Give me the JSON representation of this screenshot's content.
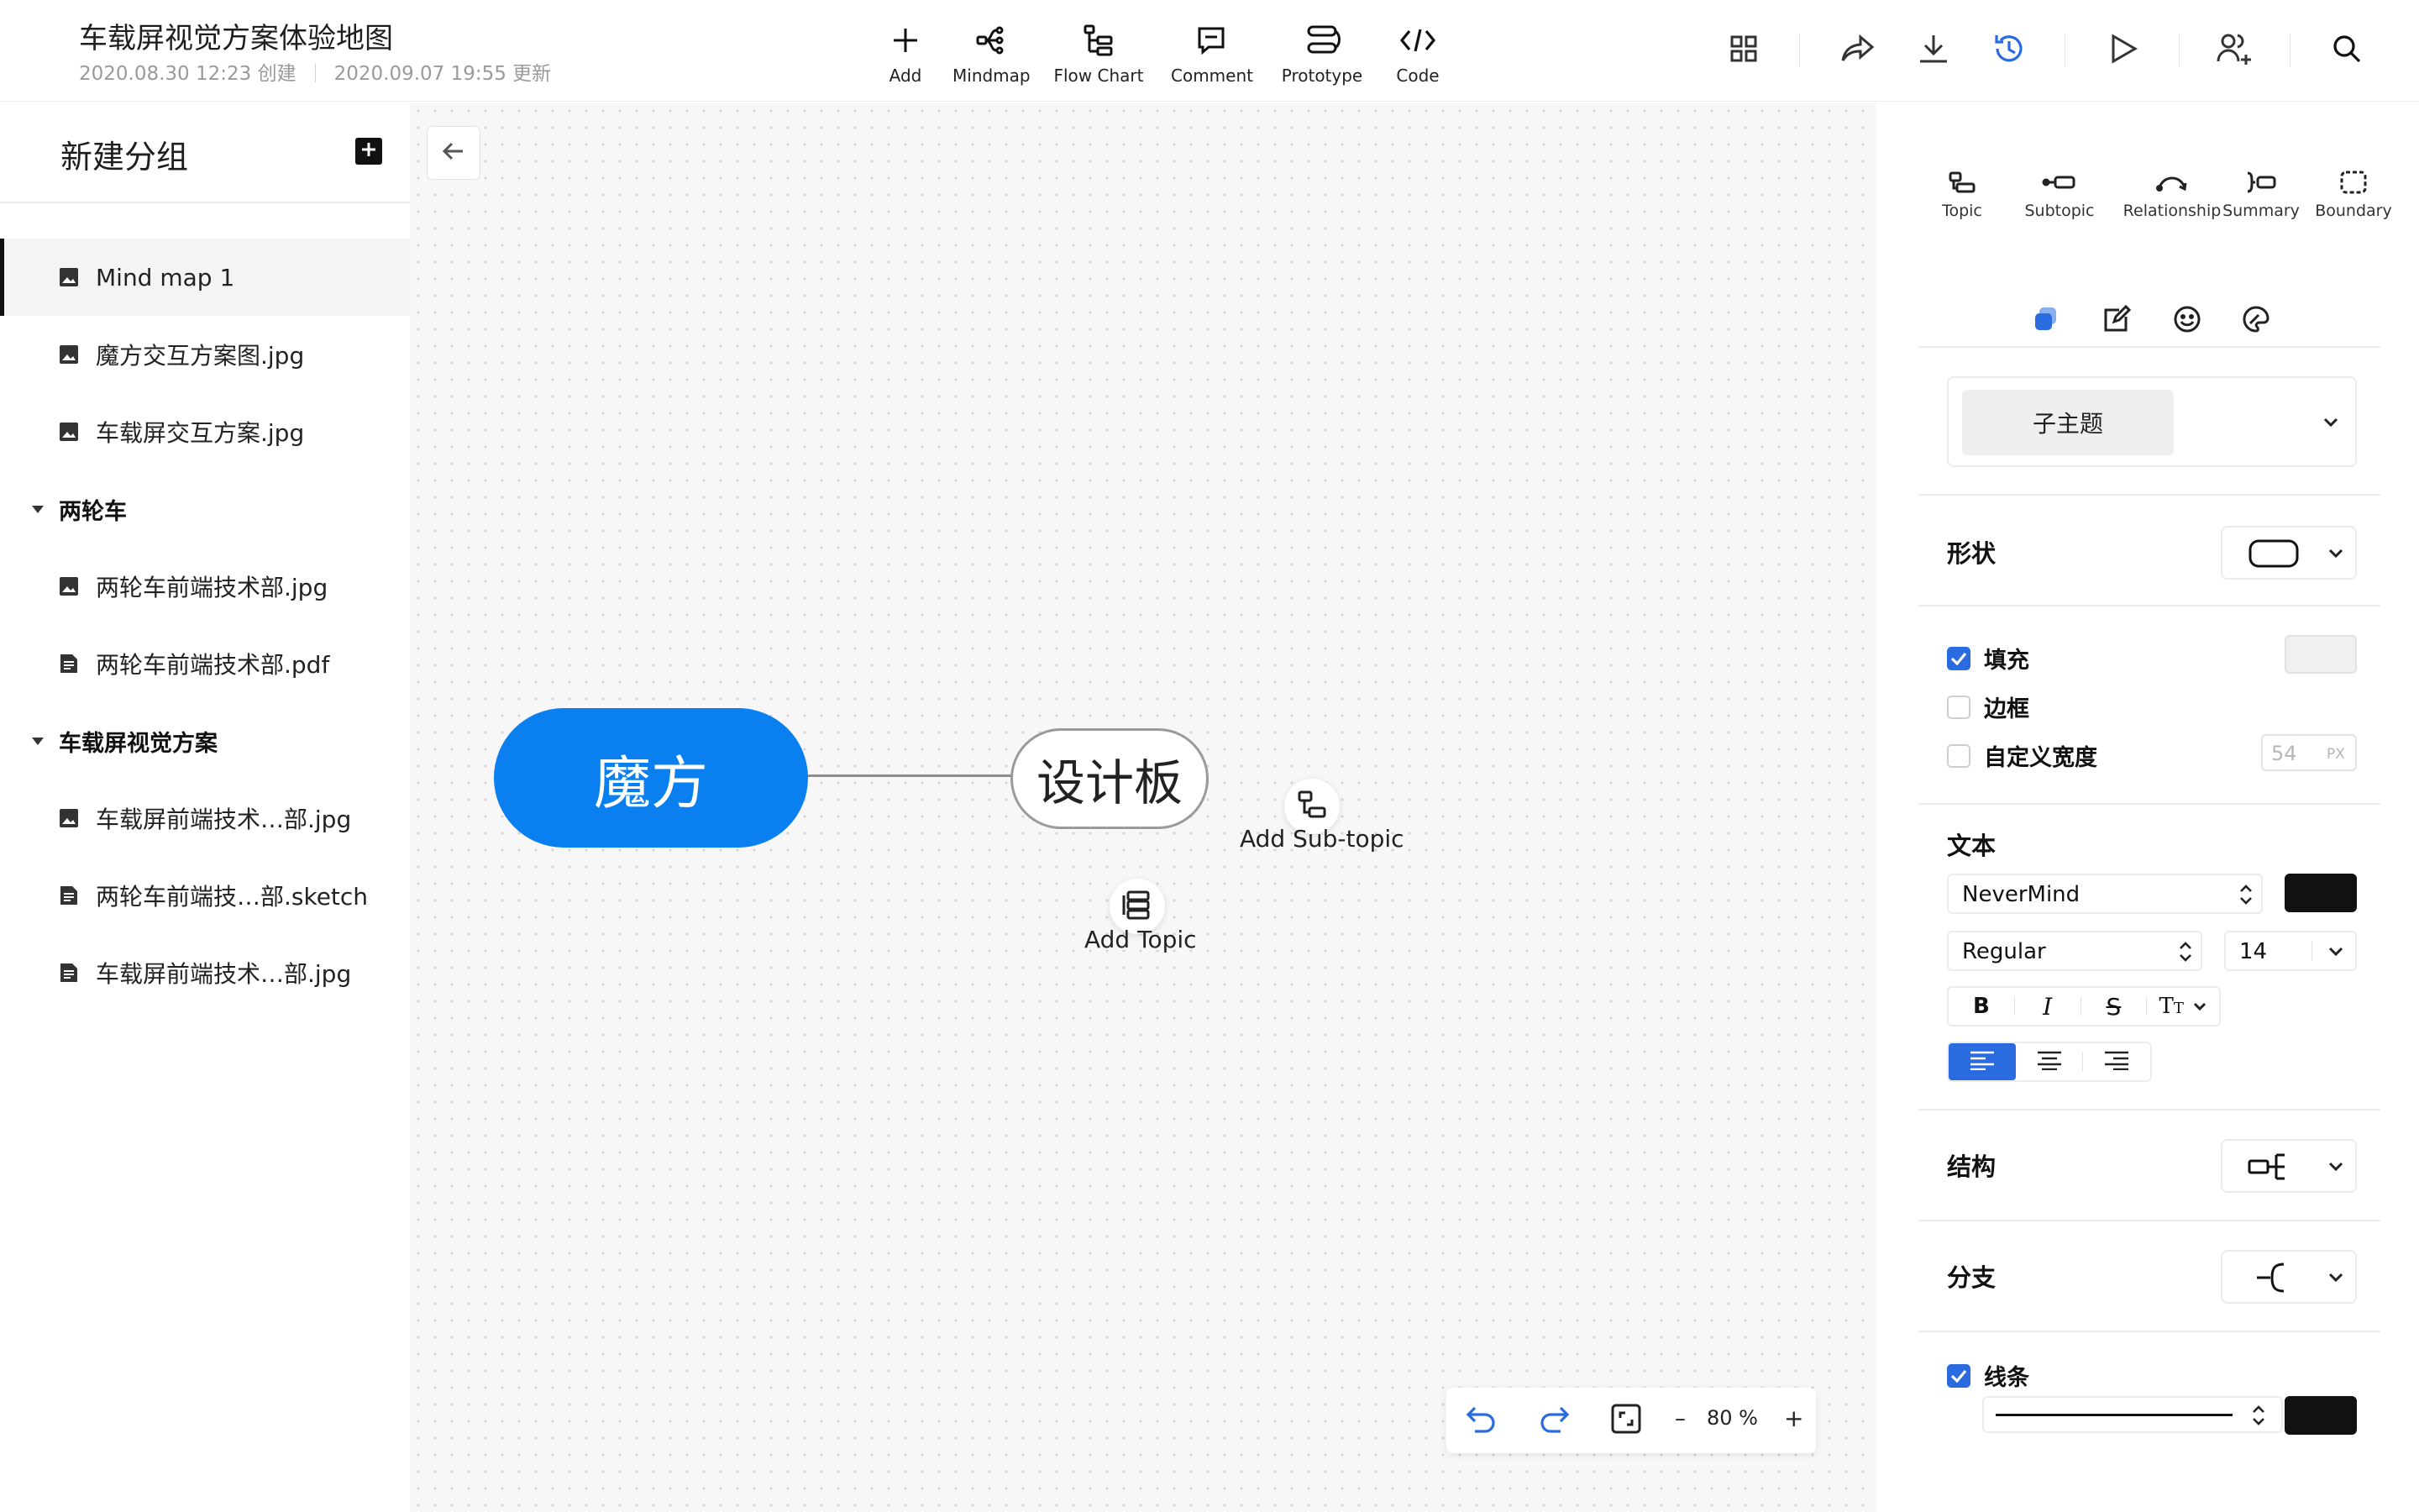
{
  "header": {
    "title": "车载屏视觉方案体验地图",
    "created": "2020.08.30 12:23 创建",
    "updated": "2020.09.07 19:55 更新",
    "toolbar": [
      {
        "key": "add",
        "label": "Add",
        "icon": "plus-icon"
      },
      {
        "key": "mindmap",
        "label": "Mindmap",
        "icon": "mindmap-icon"
      },
      {
        "key": "flowchart",
        "label": "Flow Chart",
        "icon": "flowchart-icon"
      },
      {
        "key": "comment",
        "label": "Comment",
        "icon": "comment-icon"
      },
      {
        "key": "prototype",
        "label": "Prototype",
        "icon": "prototype-icon"
      },
      {
        "key": "code",
        "label": "Code",
        "icon": "code-icon"
      }
    ],
    "right_actions": [
      "grid-icon",
      "share-icon",
      "download-icon",
      "history-icon",
      "play-icon",
      "add-user-icon",
      "search-icon"
    ]
  },
  "sidebar": {
    "group_title": "新建分组",
    "items": [
      {
        "type": "file",
        "label": "Mind map 1",
        "icon": "image-icon",
        "active": true
      },
      {
        "type": "file",
        "label": "魔方交互方案图.jpg",
        "icon": "image-icon"
      },
      {
        "type": "file",
        "label": "车载屏交互方案.jpg",
        "icon": "image-icon"
      },
      {
        "type": "folder",
        "label": "两轮车"
      },
      {
        "type": "file",
        "label": "两轮车前端技术部.jpg",
        "icon": "image-icon"
      },
      {
        "type": "file",
        "label": "两轮车前端技术部.pdf",
        "icon": "document-icon"
      },
      {
        "type": "folder",
        "label": "车载屏视觉方案"
      },
      {
        "type": "file",
        "label": "车载屏前端技术…部.jpg",
        "icon": "image-icon"
      },
      {
        "type": "file",
        "label": "两轮车前端技…部.sketch",
        "icon": "document-icon"
      },
      {
        "type": "file",
        "label": "车载屏前端技术…部.jpg",
        "icon": "document-icon"
      }
    ]
  },
  "canvas": {
    "main_topic": "魔方",
    "sub_topic": "设计板",
    "add_subtopic_label": "Add Sub-topic",
    "add_topic_label": "Add Topic",
    "zoom": {
      "minus": "–",
      "value": "80 %",
      "plus": "+"
    }
  },
  "panel": {
    "tools": [
      {
        "key": "topic",
        "label": "Topic"
      },
      {
        "key": "subtopic",
        "label": "Subtopic"
      },
      {
        "key": "relationship",
        "label": "Relationship"
      },
      {
        "key": "summary",
        "label": "Summary"
      },
      {
        "key": "boundary",
        "label": "Boundary"
      }
    ],
    "style_value": "子主题",
    "shape_label": "形状",
    "fill_label": "填充",
    "fill_checked": true,
    "border_label": "边框",
    "border_checked": false,
    "custom_width_label": "自定义宽度",
    "custom_width_checked": false,
    "custom_width_value": "54",
    "custom_width_unit": "PX",
    "text_label": "文本",
    "font_family": "NeverMind",
    "font_weight": "Regular",
    "font_size": "14",
    "bold_glyph": "B",
    "italic_glyph": "I",
    "strike_glyph": "S",
    "case_glyph": "T",
    "case_glyph_small": "T",
    "structure_label": "结构",
    "branch_label": "分支",
    "line_label": "线条",
    "line_checked": true,
    "colors": {
      "accent": "#0a7ff0",
      "checkbox": "#2a6be0",
      "text_color": "#111111",
      "line_color": "#111111"
    }
  }
}
